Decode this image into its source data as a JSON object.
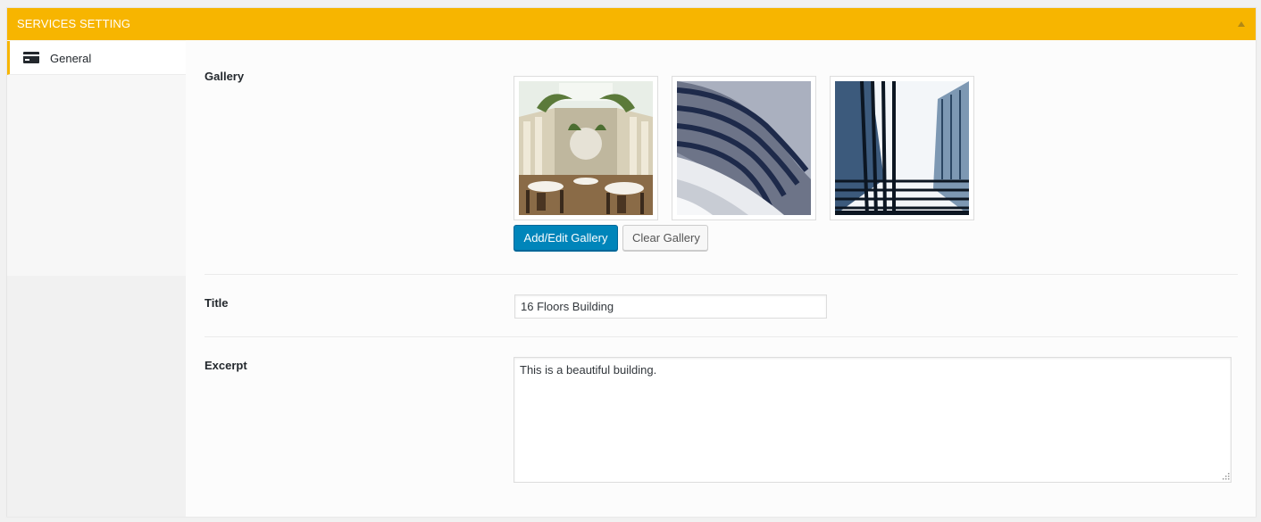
{
  "metabox": {
    "title": "SERVICES SETTING"
  },
  "sidebar": {
    "items": [
      {
        "label": "General",
        "icon": "card-icon",
        "active": true
      }
    ]
  },
  "fields": {
    "gallery": {
      "label": "Gallery",
      "images": [
        {
          "icon": "atrium-restaurant-image"
        },
        {
          "icon": "curved-building-image"
        },
        {
          "icon": "glass-tower-image"
        }
      ],
      "add_button": "Add/Edit Gallery",
      "clear_button": "Clear Gallery"
    },
    "title": {
      "label": "Title",
      "value": "16 Floors Building"
    },
    "excerpt": {
      "label": "Excerpt",
      "value": "This is a beautiful building."
    }
  },
  "colors": {
    "header": "#f7b500",
    "primary_button": "#0085ba",
    "active_tab_border": "#f7b500"
  }
}
